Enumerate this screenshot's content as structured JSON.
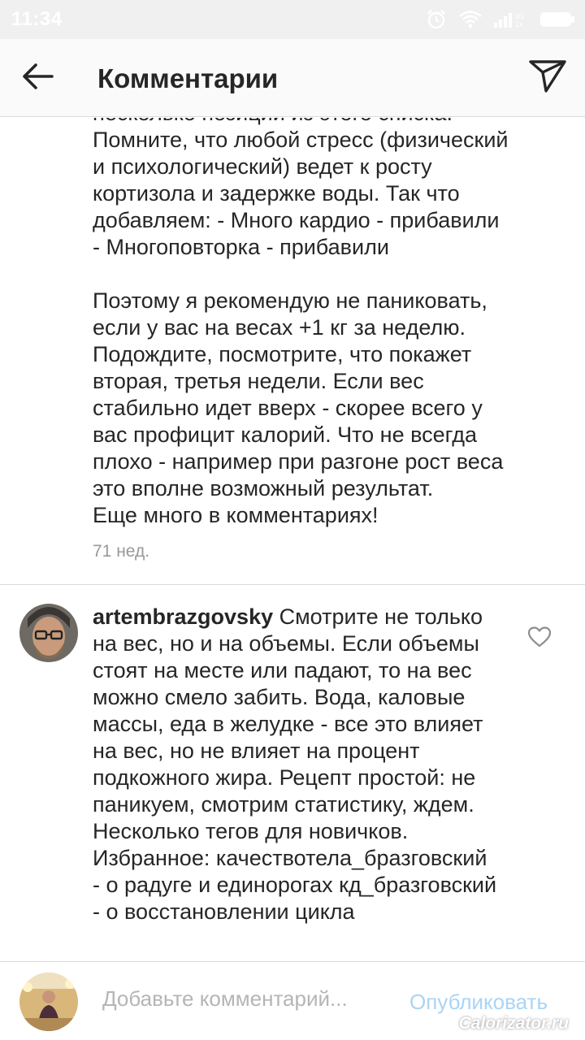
{
  "status_bar": {
    "time": "11:34",
    "icons": [
      "alarm-icon",
      "wifi-icon",
      "signal-icon",
      "battery-icon"
    ]
  },
  "header": {
    "title": "Комментарии",
    "back_icon": "arrow-left-icon",
    "direct_icon": "paper-plane-icon"
  },
  "caption": {
    "text": "несколько позиций из этого списка.\nПомните, что любой стресс (физический\nи психологический) ведет к росту\nкортизола и задержке воды. Так что\nдобавляем: - Много кардио - прибавили\n- Многоповторка - прибавили\n\nПоэтому я рекомендую не паниковать,\nесли у вас на весах +1 кг за неделю.\nПодождите, посмотрите, что покажет\nвторая, третья недели. Если вес\nстабильно идет вверх - скорее всего у\nвас профицит калорий. Что не всегда\nплохо - например при разгоне рост веса\nэто вполне возможный результат.\nЕще много в комментариях!",
    "time": "71 нед."
  },
  "comments": [
    {
      "username": "artembrazgovsky",
      "text": "Смотрите не только на вес, но и на объемы. Если объемы стоят на месте или падают, то на вес можно смело забить. Вода, каловые массы, еда в желудке - все это влияет на вес, но не влияет на процент подкожного жира.  Рецепт простой: не паникуем, смотрим статистику, ждем.  Несколько тегов для новичков.  Избранное: качествотела_бразговский - о радуге и единорогах кд_бразговский - о восстановлении цикла",
      "like_icon": "heart-outline-icon"
    }
  ],
  "footer": {
    "placeholder": "Добавьте комментарий...",
    "publish_label": "Опубликовать",
    "watermark": "Calorizator.ru"
  },
  "colors": {
    "text": "#262626",
    "muted": "#999999",
    "link_disabled": "#a9d4f5",
    "divider": "#dbdbdb",
    "header_bg": "#fafafa"
  }
}
